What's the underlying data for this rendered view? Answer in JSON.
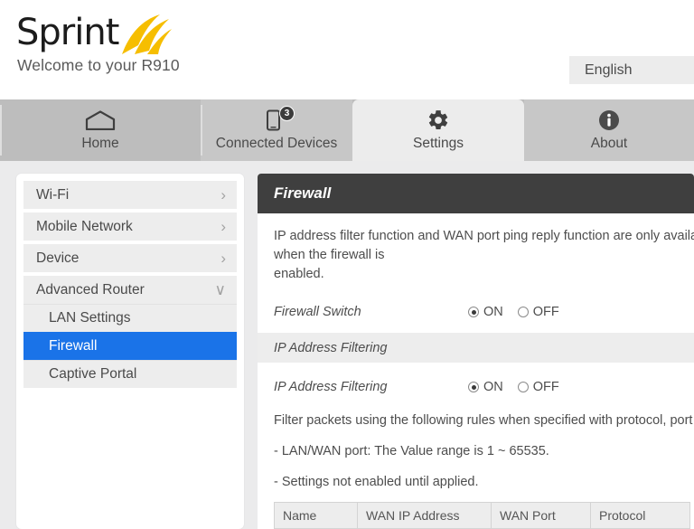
{
  "header": {
    "brand": "Sprint",
    "brand_accent": "#f6be00",
    "welcome": "Welcome to your R910",
    "language": "English"
  },
  "nav": {
    "tabs": [
      {
        "label": "Home",
        "icon": "home-icon",
        "active": false,
        "badge": null
      },
      {
        "label": "Connected Devices",
        "icon": "devices-icon",
        "active": false,
        "badge": "3"
      },
      {
        "label": "Settings",
        "icon": "gear-icon",
        "active": true,
        "badge": null
      },
      {
        "label": "About",
        "icon": "info-icon",
        "active": false,
        "badge": null
      }
    ]
  },
  "sidebar": {
    "items": [
      {
        "label": "Wi-Fi",
        "chevron": "›",
        "expanded": false
      },
      {
        "label": "Mobile Network",
        "chevron": "›",
        "expanded": false
      },
      {
        "label": "Device",
        "chevron": "›",
        "expanded": false
      },
      {
        "label": "Advanced Router",
        "chevron": "∨",
        "expanded": true
      }
    ],
    "subitems": [
      {
        "label": "LAN Settings",
        "selected": false
      },
      {
        "label": "Firewall",
        "selected": true
      },
      {
        "label": "Captive Portal",
        "selected": false
      }
    ],
    "selected_color": "#1a73e8"
  },
  "panel": {
    "title": "Firewall",
    "description": "IP address filter function and WAN port ping reply function are only available when the firewall is\nenabled.",
    "firewall_switch": {
      "label": "Firewall Switch",
      "options": [
        "ON",
        "OFF"
      ],
      "selected": "ON"
    },
    "section_header": "IP Address Filtering",
    "ip_filtering": {
      "label": "IP Address Filtering",
      "options": [
        "ON",
        "OFF"
      ],
      "selected": "ON"
    },
    "notes": [
      "Filter packets using the following rules when specified with protocol, port and IP address.",
      "- LAN/WAN port: The Value range is 1 ~ 65535.",
      "- Settings not enabled until applied."
    ],
    "table": {
      "columns": [
        "Name",
        "WAN IP Address",
        "WAN Port",
        "Protocol"
      ]
    }
  }
}
